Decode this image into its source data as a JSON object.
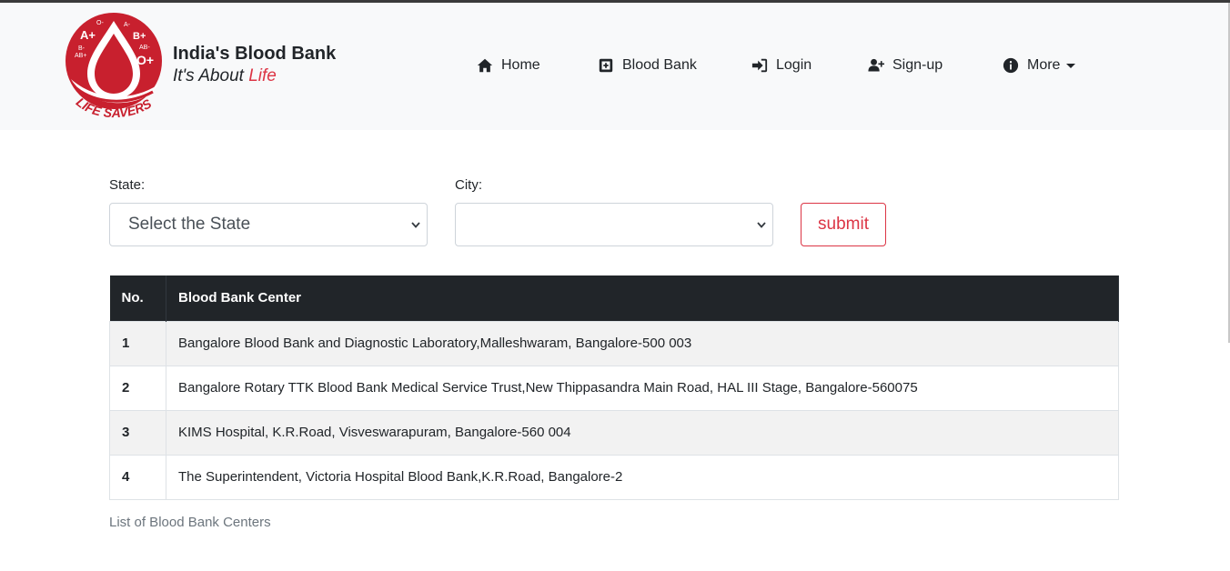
{
  "brand": {
    "logo_groups": [
      "A+",
      "O-",
      "A-",
      "B+",
      "B-",
      "AB-",
      "AB+",
      "O+"
    ],
    "logo_ring_text": "LIFE SAVERS",
    "title": "India's Blood Bank",
    "tagline_prefix": "It's About ",
    "tagline_emphasis": "Life"
  },
  "nav": {
    "home": "Home",
    "blood_bank": "Blood Bank",
    "login": "Login",
    "signup": "Sign-up",
    "more": "More"
  },
  "form": {
    "state_label": "State:",
    "state_value": "Select the State",
    "city_label": "City:",
    "city_value": "",
    "submit_label": "submit"
  },
  "table": {
    "headers": [
      "No.",
      "Blood Bank Center"
    ],
    "rows": [
      {
        "no": "1",
        "center": "Bangalore Blood Bank and Diagnostic Laboratory,Malleshwaram, Bangalore-500 003"
      },
      {
        "no": "2",
        "center": "Bangalore Rotary TTK Blood Bank Medical Service Trust,New Thippasandra Main Road, HAL III Stage, Bangalore-560075"
      },
      {
        "no": "3",
        "center": "KIMS Hospital, K.R.Road, Visveswarapuram, Bangalore-560 004"
      },
      {
        "no": "4",
        "center": "The Superintendent, Victoria Hospital Blood Bank,K.R.Road, Bangalore-2"
      }
    ],
    "caption": "List of Blood Bank Centers"
  },
  "colors": {
    "brand_red": "#c8202e",
    "submit_red": "#dc3545",
    "navbar_bg": "#f8f9fa",
    "table_header_bg": "#212529"
  },
  "icons": {
    "home": "home-icon",
    "blood_bank": "hospital-plus-icon",
    "login": "sign-in-icon",
    "signup": "user-plus-icon",
    "more": "info-circle-icon"
  }
}
